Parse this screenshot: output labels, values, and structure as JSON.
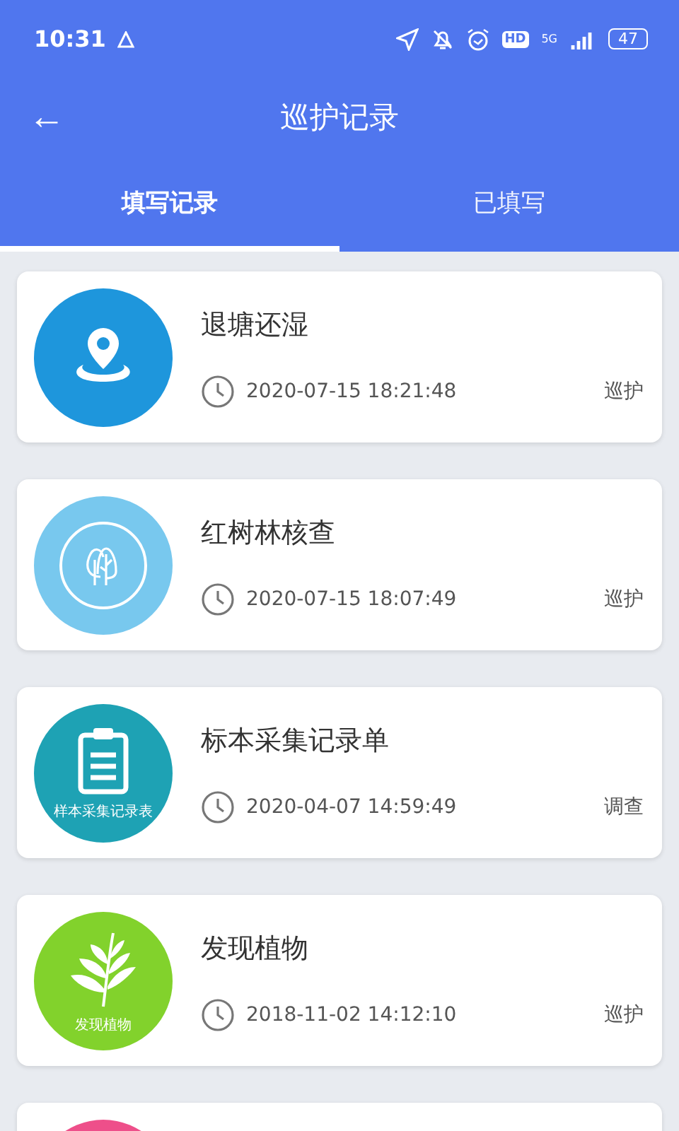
{
  "status_bar": {
    "time": "10:31",
    "hd": "HD",
    "network": "5G",
    "battery": "47"
  },
  "header": {
    "back": "←",
    "title": "巡护记录"
  },
  "tabs": [
    {
      "label": "填写记录",
      "selected": true
    },
    {
      "label": "已填写",
      "selected": false
    }
  ],
  "records": [
    {
      "kind": "pin",
      "color": "#1e96dc",
      "title": "退塘还湿",
      "time": "2020-07-15 18:21:48",
      "tag": "巡护"
    },
    {
      "kind": "trees",
      "color": "#78c8ee",
      "title": "红树林核查",
      "time": "2020-07-15 18:07:49",
      "tag": "巡护"
    },
    {
      "kind": "clipboard",
      "color": "#1ea2b4",
      "icon_label": "样本采集记录表",
      "title": "标本采集记录单",
      "time": "2020-04-07 14:59:49",
      "tag": "调查"
    },
    {
      "kind": "plant",
      "color": "#82d22c",
      "icon_label": "发现植物",
      "title": "发现植物",
      "time": "2018-11-02 14:12:10",
      "tag": "巡护"
    },
    {
      "kind": "blank",
      "color": "#ee4f8a"
    }
  ]
}
